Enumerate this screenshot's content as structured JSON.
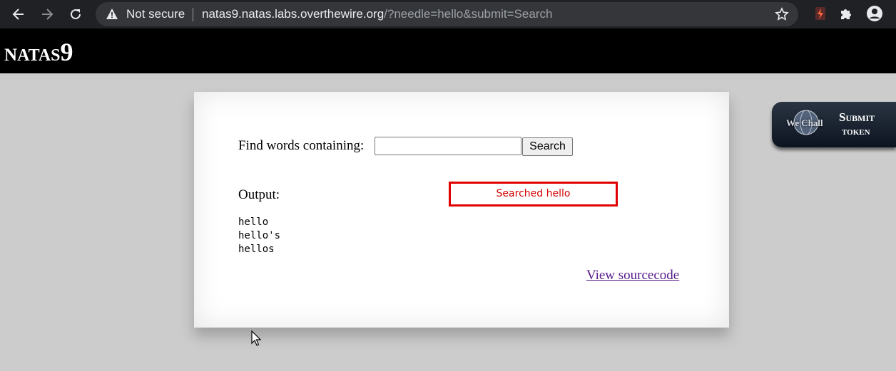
{
  "browser": {
    "security_label": "Not secure",
    "url_host": "natas9.natas.labs.overthewire.org",
    "url_path": "/?needle=hello&submit=Search"
  },
  "site": {
    "title_prefix": "N",
    "title_middle": "ATAS",
    "title_number": "9"
  },
  "form": {
    "find_label": "Find words containing:",
    "needle_value": "",
    "search_label": "Search"
  },
  "output": {
    "label": "Output:",
    "annotation": "Searched hello",
    "results": [
      "hello",
      "hello's",
      "hellos"
    ]
  },
  "footer": {
    "view_source": "View sourcecode"
  },
  "wechall": {
    "brand": "We Chall",
    "submit_line1": "Submit",
    "submit_line2": "token"
  },
  "colors": {
    "annotation_border": "#e00000",
    "link": "#551a8b",
    "page_background": "#cccccc",
    "header_background": "#000000"
  },
  "icons": {
    "back": "arrow-left-icon",
    "forward": "arrow-right-icon",
    "reload": "reload-icon",
    "warning": "warning-triangle-icon",
    "bookmark": "star-icon",
    "extensions": "puzzle-icon",
    "profile": "account-circle-icon"
  }
}
